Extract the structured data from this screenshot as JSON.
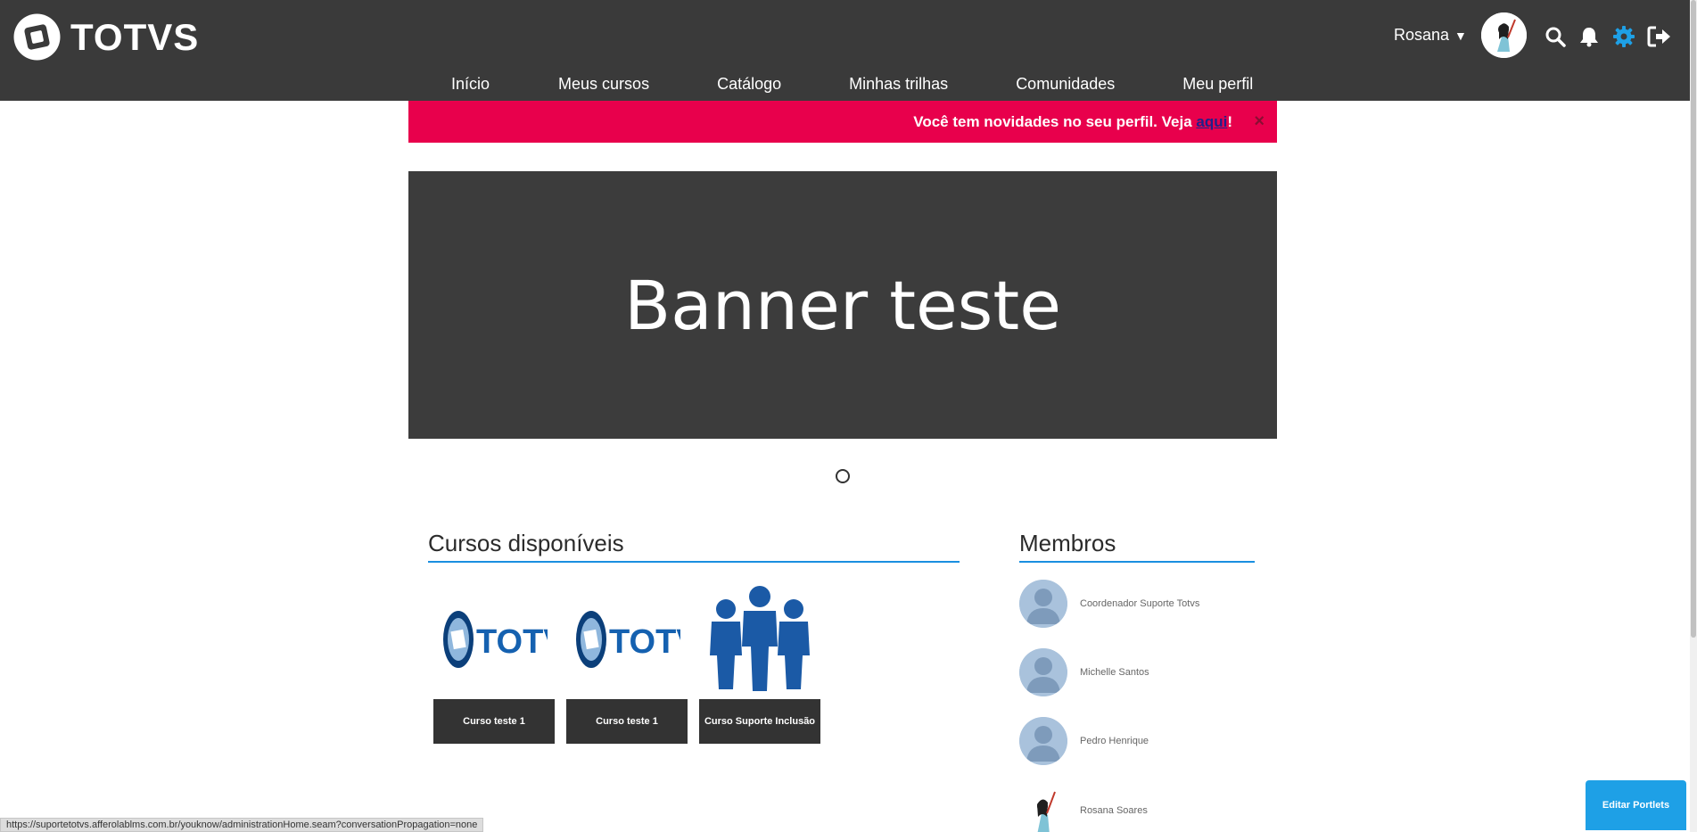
{
  "header": {
    "logo_text": "TOTVS",
    "user_name": "Rosana",
    "user_caret": "▼"
  },
  "nav": {
    "items": [
      "Início",
      "Meus cursos",
      "Catálogo",
      "Minhas trilhas",
      "Comunidades",
      "Meu perfil"
    ]
  },
  "notice": {
    "text_before": "Você tem novidades no seu perfil. Veja ",
    "link": "aqui",
    "text_after": "!",
    "close": "×"
  },
  "banner": {
    "text": "Banner teste"
  },
  "courses": {
    "title": "Cursos disponíveis",
    "items": [
      {
        "label": "Curso teste 1",
        "image": "totvs-logo"
      },
      {
        "label": "Curso teste 1",
        "image": "totvs-logo"
      },
      {
        "label": "Curso Suporte Inclusão",
        "image": "people-group"
      }
    ]
  },
  "members": {
    "title": "Membros",
    "items": [
      {
        "name": "Coordenador Suporte Totvs",
        "avatar": "default-avatar"
      },
      {
        "name": "Michelle Santos",
        "avatar": "default-avatar"
      },
      {
        "name": "Pedro Henrique",
        "avatar": "default-avatar"
      },
      {
        "name": "Rosana Soares",
        "avatar": "user-photo"
      }
    ]
  },
  "status_bar": {
    "url": "https://suportetotvs.afferolablms.com.br/youknow/administrationHome.seam?conversationPropagation=none"
  },
  "edit_portlets": {
    "label": "Editar Portlets"
  },
  "colors": {
    "header_bg": "#3a3a3a",
    "notice_bg": "#e8004c",
    "accent": "#1a8fe0",
    "gear": "#1ea0e6"
  }
}
